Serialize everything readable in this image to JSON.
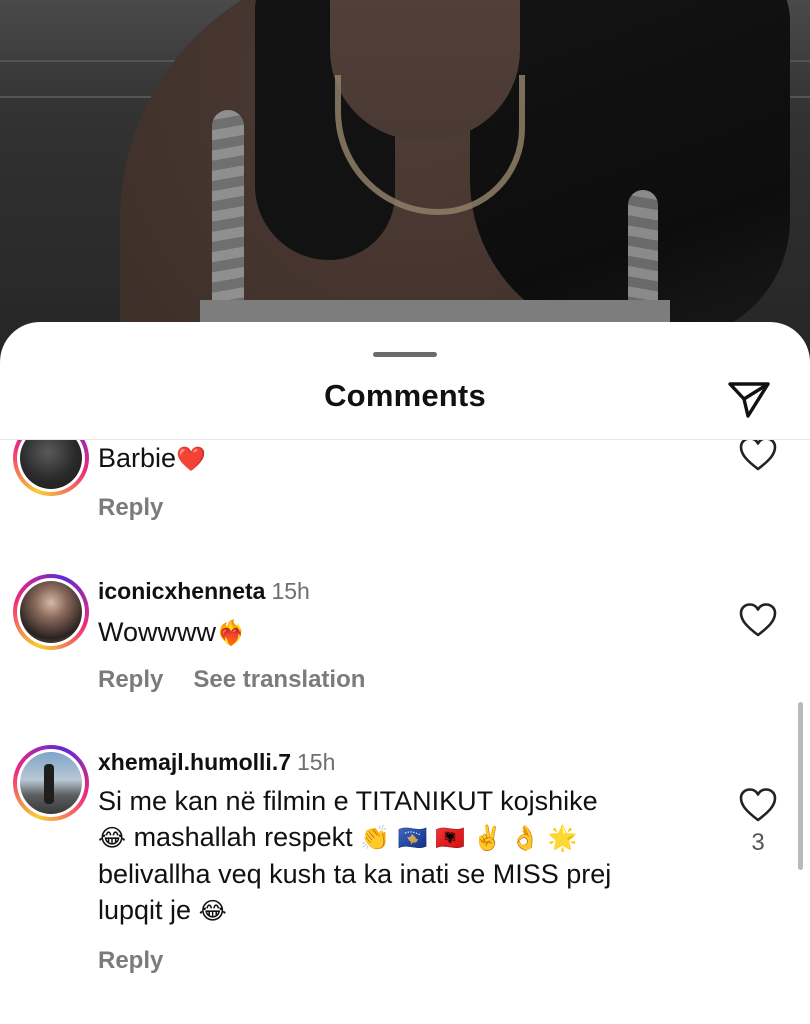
{
  "sheet": {
    "title": "Comments",
    "share_icon": "paper-plane-icon"
  },
  "comments": [
    {
      "username": "",
      "time": "",
      "text": "Barbie",
      "emoji": "❤️",
      "reply_label": "Reply",
      "avatar_icon": "user-avatar"
    },
    {
      "username": "iconicxhenneta",
      "time": "15h",
      "text": "Wowwww",
      "emoji": "❤️‍🔥",
      "reply_label": "Reply",
      "translate_label": "See translation",
      "avatar_icon": "user-avatar"
    },
    {
      "username": "xhemajl.humolli.7",
      "time": "15h",
      "line1": "Si me kan në filmin e TITANIKUT kojshike",
      "line2_emoji_a": "😂",
      "line2_text": "mashallah respekt",
      "line2_emoji_b": "👏 🇽🇰 🇦🇱 ✌️ 👌 🌟",
      "line3": "belivallha veq kush ta ka inati  se MISS prej",
      "line4_text": "lupqit  je",
      "line4_emoji": "😂",
      "reply_label": "Reply",
      "likes": "3",
      "avatar_icon": "user-avatar"
    }
  ],
  "colors": {
    "accent_ring_start": "#f9ce34",
    "accent_ring_mid": "#ee2a7b",
    "accent_ring_end": "#6228d7",
    "secondary_text": "#7b7b7b",
    "primary_text": "#111111"
  }
}
